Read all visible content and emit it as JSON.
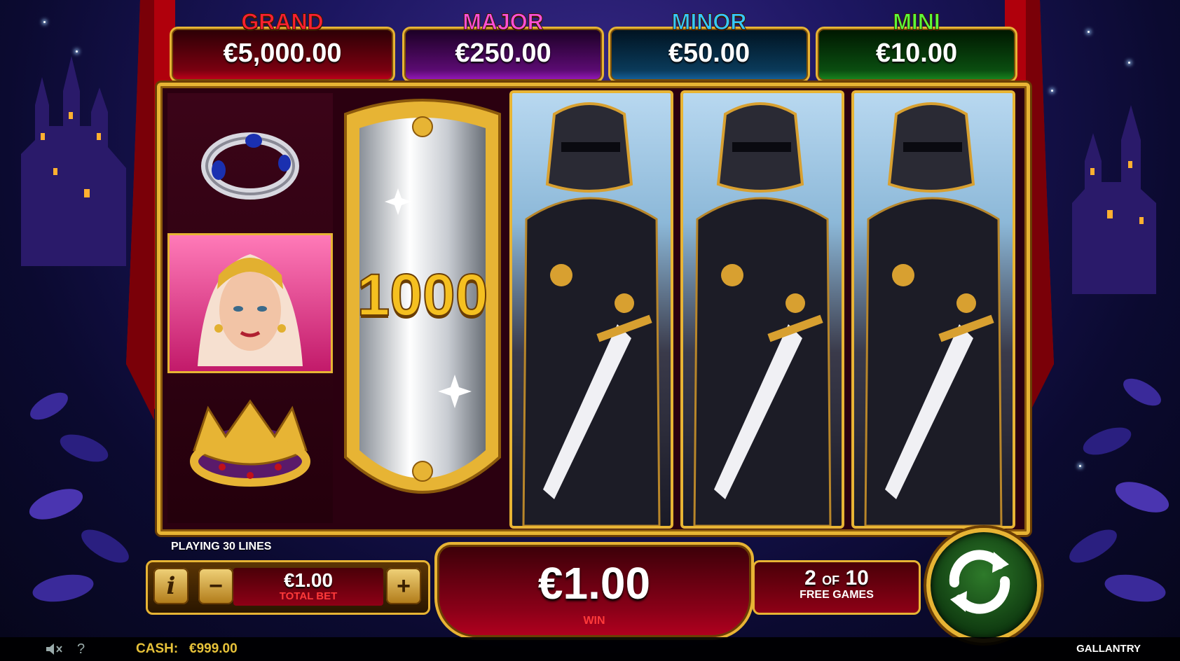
{
  "game": {
    "name": "GALLANTRY"
  },
  "jackpots": {
    "grand": {
      "title": "GRAND",
      "value": "€5,000.00",
      "color": "#ff2030"
    },
    "major": {
      "title": "MAJOR",
      "value": "€250.00",
      "color": "#ff4fd8"
    },
    "minor": {
      "title": "MINOR",
      "value": "€50.00",
      "color": "#34c8ff"
    },
    "mini": {
      "title": "MINI",
      "value": "€10.00",
      "color": "#5cff3a"
    }
  },
  "reels": {
    "reel1": [
      "sapphire-ring-symbol",
      "princess-symbol",
      "crown-symbol"
    ],
    "reel2": {
      "symbol": "silver-shield-symbol",
      "value": "1000"
    },
    "reel3": "black-knight-symbol",
    "reel4": "black-knight-symbol",
    "reel5": "black-knight-symbol"
  },
  "controls": {
    "lines_label": "PLAYING 30 LINES",
    "info_label": "i",
    "minus_label": "−",
    "plus_label": "+",
    "bet_value": "€1.00",
    "bet_label": "TOTAL BET",
    "win_value": "€1.00",
    "win_label": "WIN",
    "free_current": "2",
    "free_of": "OF",
    "free_total": "10",
    "free_label": "FREE GAMES",
    "spin_icon": "spin-arrows-icon"
  },
  "status": {
    "cash_label": "CASH:",
    "cash_value": "€999.00",
    "sound_icon": "speaker-muted-icon",
    "help_label": "?"
  },
  "colors": {
    "gold": "#e7b434",
    "red_label": "#ff3a3a",
    "cash": "#e7c23a"
  }
}
